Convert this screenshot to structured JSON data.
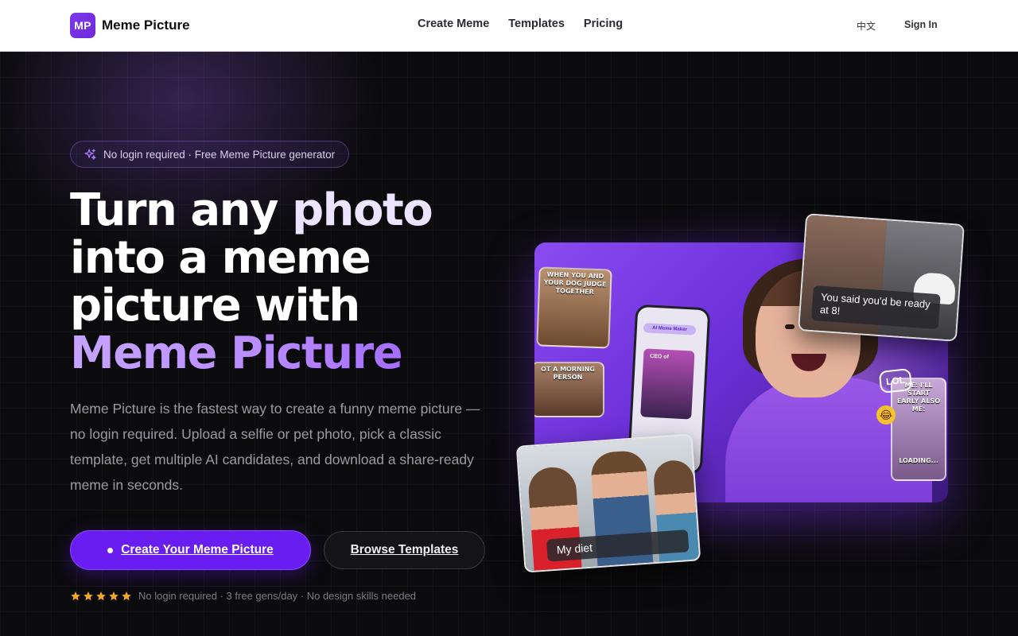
{
  "brand": {
    "mark": "MP",
    "name": "Meme Picture"
  },
  "nav": {
    "links": [
      "Create Meme",
      "Templates",
      "Pricing"
    ],
    "lang": "中文",
    "signin": "Sign In"
  },
  "hero": {
    "badge": "No login required · Free Meme Picture generator",
    "headline": {
      "line1_a": "Turn any ",
      "line1_b": "photo",
      "line2": "into a meme",
      "line3": "picture with",
      "line4": "Meme Picture"
    },
    "description": "Meme Picture is the fastest way to create a funny meme picture — no login required. Upload a selfie or pet photo, pick a classic template, get multiple AI candidates, and download a share-ready meme in seconds.",
    "cta_primary": "Create Your Meme Picture",
    "cta_secondary": "Browse Templates",
    "rating_stars": 5,
    "trust_text": "No login required · 3 free gens/day · No design skills needed"
  },
  "collage": {
    "tile_dog_caption": "WHEN YOU AND YOUR DOG JUDGE TOGETHER",
    "tile_morning_caption": "OT A MORNING PERSON",
    "tile_right_caption": "ME: I'LL START EARLY ALSO ME:",
    "tile_right_sub": "LOADING...",
    "phone_header": "AI Meme Maker",
    "phone_caption": "CEO of",
    "lol": "LOL",
    "emoji": "😂",
    "top_card_caption": "You said you'd be ready at 8!",
    "bottom_card_caption": "My diet"
  },
  "colors": {
    "accent": "#6a1df0",
    "accent_light": "#b98cff",
    "star": "#f5a623",
    "background": "#0b0b0d"
  }
}
